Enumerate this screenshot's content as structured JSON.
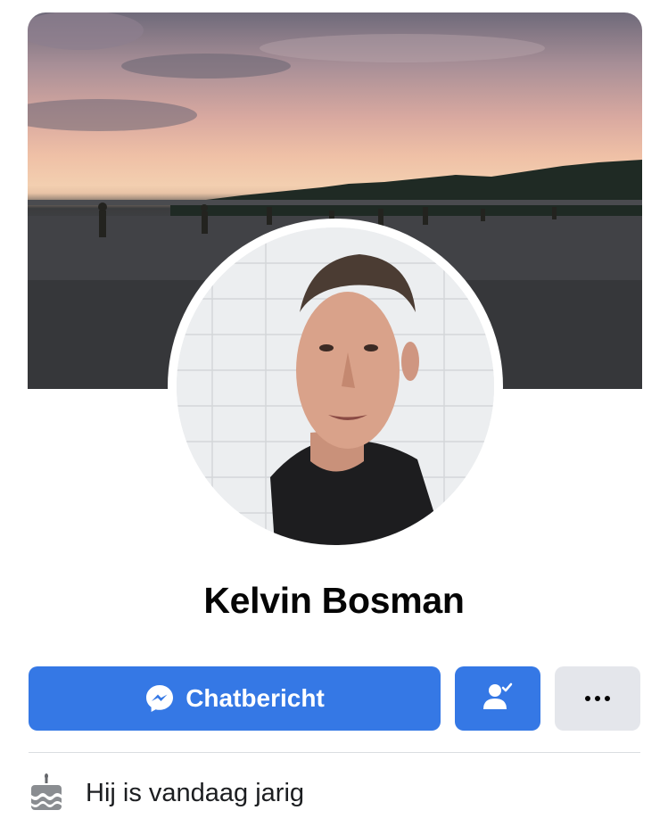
{
  "profile": {
    "name": "Kelvin Bosman"
  },
  "actions": {
    "chat_label": "Chatbericht",
    "chat_icon": "messenger-icon",
    "friend_icon": "friend-check-icon",
    "more_icon": "more-dots-icon"
  },
  "info": {
    "birthday_text": "Hij is vandaag jarig",
    "birthday_icon": "birthday-cake-icon"
  },
  "colors": {
    "primary": "#3578e5",
    "secondary_button": "#e4e6eb",
    "text": "#050505",
    "divider": "#dadde1"
  }
}
